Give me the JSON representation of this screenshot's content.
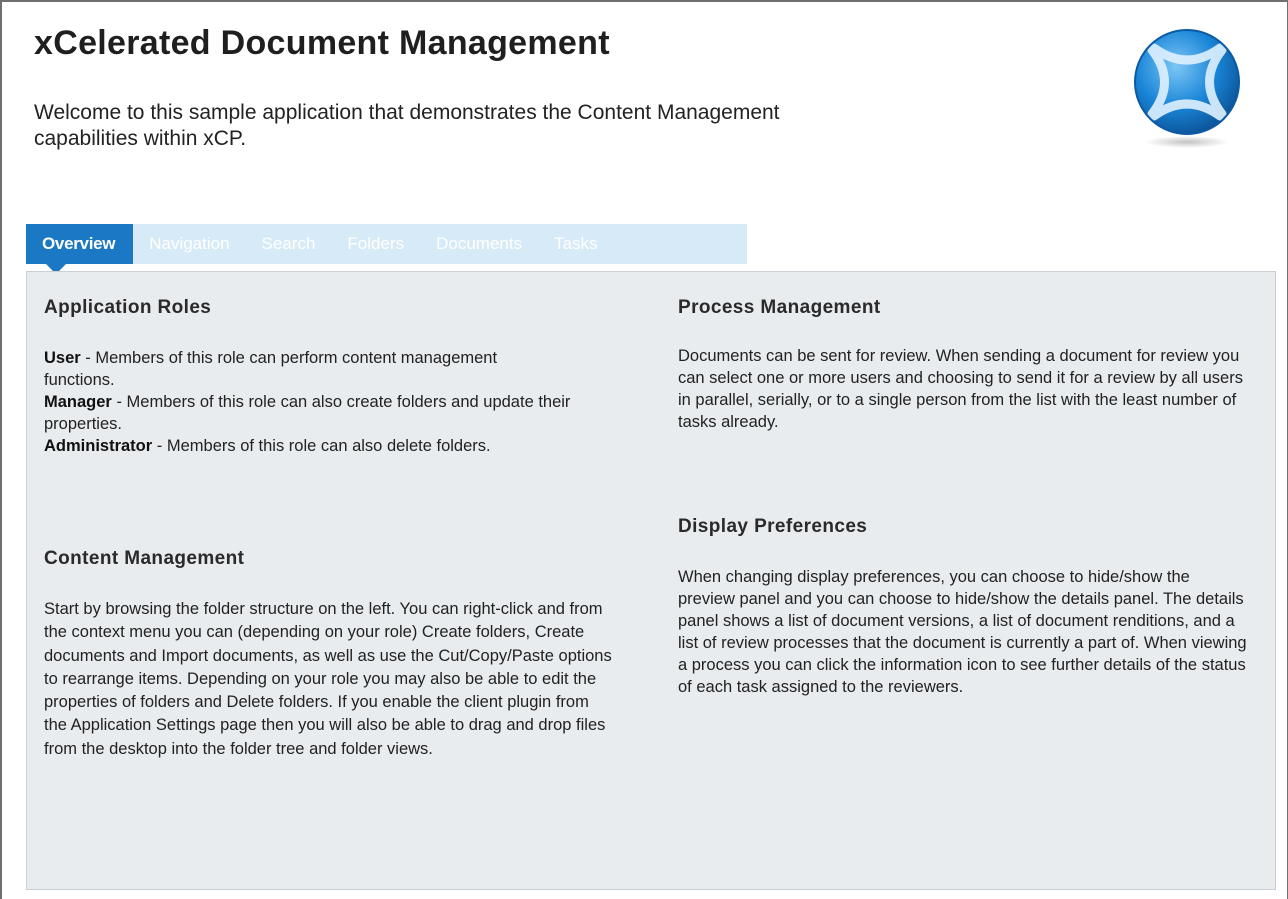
{
  "header": {
    "title": "xCelerated Document Management",
    "welcome": "Welcome to this sample application that demonstrates the Content Management capabilities within xCP."
  },
  "tabs": [
    {
      "label": "Overview",
      "active": true
    },
    {
      "label": "Navigation",
      "active": false
    },
    {
      "label": "Search",
      "active": false
    },
    {
      "label": "Folders",
      "active": false
    },
    {
      "label": "Documents",
      "active": false
    },
    {
      "label": "Tasks",
      "active": false
    }
  ],
  "overview": {
    "application_roles": {
      "heading": "Application Roles",
      "roles": [
        {
          "name": "User",
          "description": " - Members of this role can perform content management functions."
        },
        {
          "name": "Manager",
          "description": " - Members of this role can also create folders and update their properties."
        },
        {
          "name": "Administrator",
          "description": " - Members of this role can also delete folders."
        }
      ]
    },
    "content_management": {
      "heading": "Content Management",
      "text": "Start by browsing the folder structure on the left. You can right-click and from the context menu you can (depending on your role) Create folders, Create documents and Import documents, as well as use the Cut/Copy/Paste options to rearrange items. Depending on your role you may also be able to edit the properties of folders and Delete folders. If you enable the client plugin from the Application Settings page then you will also be able to drag and drop files from the desktop into the folder tree and folder views."
    },
    "process_management": {
      "heading": "Process Management",
      "text": "Documents can be sent for review. When sending a document for review you can select one or more users and choosing to send it for a review by all users in parallel, serially, or to a single person from the list with the least number of tasks already."
    },
    "display_preferences": {
      "heading": "Display Preferences",
      "text": "When changing display preferences, you can choose to hide/show the preview panel and you can choose to hide/show the details panel. The details panel shows a list of document versions, a list of document renditions, and a list of review processes that the document is currently a part of. When viewing a process you can click the information icon to see further details of the status of each task assigned to the reviewers."
    }
  },
  "colors": {
    "tab_active": "#1b78c4",
    "tab_bar": "#d7eaf7",
    "panel_bg": "#e8ecef",
    "logo_blue": "#1a86d8"
  },
  "icons": {
    "logo": "xcp-logo-icon"
  }
}
